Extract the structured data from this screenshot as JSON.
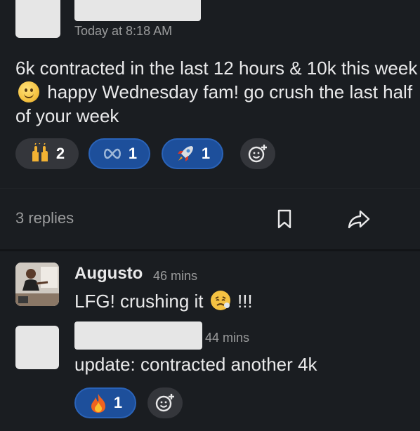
{
  "post": {
    "timestamp": "Today at 8:18 AM",
    "text_part1": "6k contracted in the last 12 hours & 10k this week",
    "text_part2": "happy Wednesday fam! go crush the last half of your week",
    "reactions": [
      {
        "icon": "raised-hands-icon",
        "count": "2",
        "active": false
      },
      {
        "icon": "infinity-icon",
        "count": "1",
        "active": true
      },
      {
        "icon": "rocket-icon",
        "count": "1",
        "active": true
      }
    ]
  },
  "thread": {
    "replies_label": "3 replies"
  },
  "reply1": {
    "username": "Augusto",
    "time": "46 mins",
    "text": "LFG! crushing it",
    "suffix": "!!!"
  },
  "reply2": {
    "time": "44 mins",
    "text": "update: contracted another 4k",
    "reaction": {
      "icon": "fire-icon",
      "count": "1",
      "active": true
    }
  },
  "colors": {
    "background": "#1a1d21",
    "pill_neutral": "#34363b",
    "pill_active": "#1d4f9b",
    "muted_text": "#9a9b9c"
  }
}
